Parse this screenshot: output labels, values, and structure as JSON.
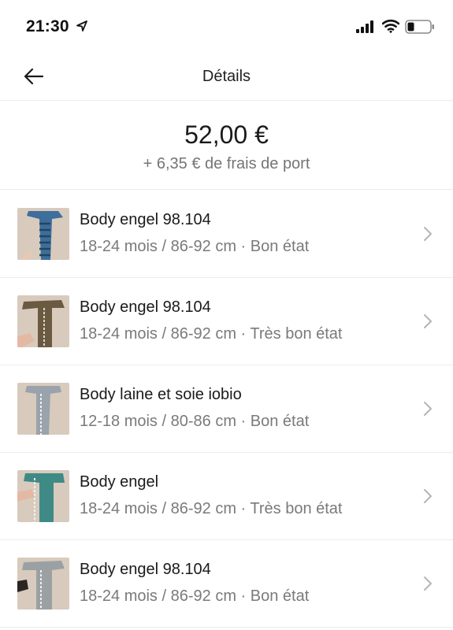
{
  "status_bar": {
    "time": "21:30",
    "icons": [
      "location-arrow-icon",
      "cellular-signal-icon",
      "wifi-icon",
      "battery-icon"
    ]
  },
  "nav": {
    "back_icon": "arrow-left-icon",
    "title": "Détails"
  },
  "price": {
    "total": "52,00 €",
    "shipping": "+ 6,35 € de frais de port"
  },
  "items": [
    {
      "title": "Body engel 98.104",
      "meta": "18-24 mois / 86-92 cm · Bon état",
      "thumb_color": "#3d6e9c"
    },
    {
      "title": "Body engel 98.104",
      "meta": "18-24 mois / 86-92 cm · Très bon état",
      "thumb_color": "#6b5a42"
    },
    {
      "title": "Body laine et soie iobio",
      "meta": "12-18 mois / 80-86 cm · Bon état",
      "thumb_color": "#9aa3ab"
    },
    {
      "title": "Body engel",
      "meta": "18-24 mois / 86-92 cm · Très bon état",
      "thumb_color": "#3f8a86"
    },
    {
      "title": "Body engel 98.104",
      "meta": "18-24 mois / 86-92 cm · Bon état",
      "thumb_color": "#9ba1a3"
    }
  ],
  "colors": {
    "divider": "#ececec",
    "secondary_text": "#7a7a7a",
    "floor": "#d8cbbd"
  }
}
